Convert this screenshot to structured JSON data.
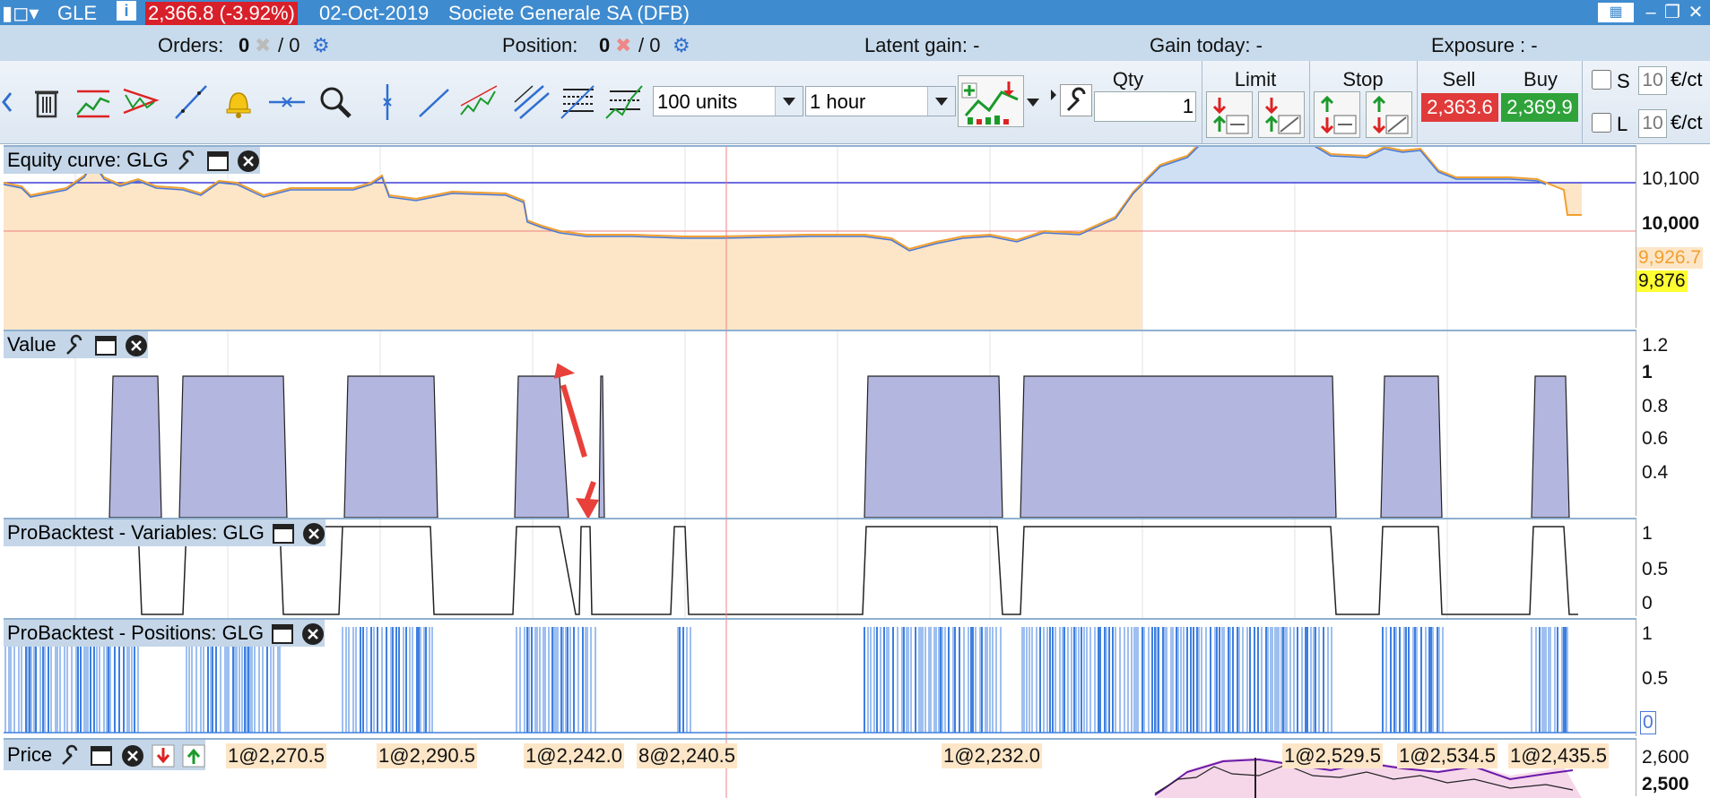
{
  "title_bar": {
    "ticker": "GLE",
    "price_change": "2,366.8 (-3.92%)",
    "date": "02-Oct-2019",
    "instrument": "Societe Generale SA (DFB)"
  },
  "orders_bar": {
    "orders_label": "Orders:",
    "orders_value": "0",
    "orders_slash": "/ 0",
    "position_label": "Position:",
    "position_value": "0",
    "position_slash": "/ 0",
    "latent_gain": "Latent gain: -",
    "gain_today": "Gain today: -",
    "exposure": "Exposure : -"
  },
  "toolbar": {
    "units_select": "100 units",
    "timeframe_select": "1 hour",
    "qty_label": "Qty",
    "qty_value": "1",
    "limit_label": "Limit",
    "stop_label": "Stop",
    "sell_label": "Sell",
    "buy_label": "Buy",
    "sell_price": "2,363.6",
    "buy_price": "2,369.9",
    "s_label": "S",
    "l_label": "L",
    "s_value": "10",
    "l_value": "10",
    "unit_text": "€/ct"
  },
  "colors": {
    "title_bg": "#3f8bcf",
    "sell_bg": "#e03a3a",
    "buy_bg": "#2fa33a",
    "equity_below_fill": "#fde6c7",
    "equity_above_fill": "#cfe0f5",
    "value_fill": "#b3b6de",
    "positions_line": "#3e7fe0"
  },
  "panels": {
    "equity": {
      "title": "Equity curve: GLG",
      "ticks": [
        "10,100",
        "10,000"
      ],
      "last_value": "9,926.7",
      "marker_value": "9,876"
    },
    "value": {
      "title": "Value",
      "ticks": [
        "1.2",
        "1",
        "0.8",
        "0.6",
        "0.4"
      ]
    },
    "variables": {
      "title": "ProBacktest - Variables: GLG",
      "ticks": [
        "1",
        "0.5",
        "0"
      ]
    },
    "positions": {
      "title": "ProBacktest - Positions: GLG",
      "ticks": [
        "1",
        "0.5",
        "0"
      ]
    },
    "price": {
      "title": "Price",
      "ticks": [
        "2,600",
        "2,500"
      ],
      "trade_labels": [
        "1@2,270.5",
        "1@2,290.5",
        "1@2,242.0",
        "8@2,240.5",
        "1@2,232.0",
        "1@2,529.5",
        "1@2,534.5",
        "1@2,435.5"
      ]
    }
  }
}
